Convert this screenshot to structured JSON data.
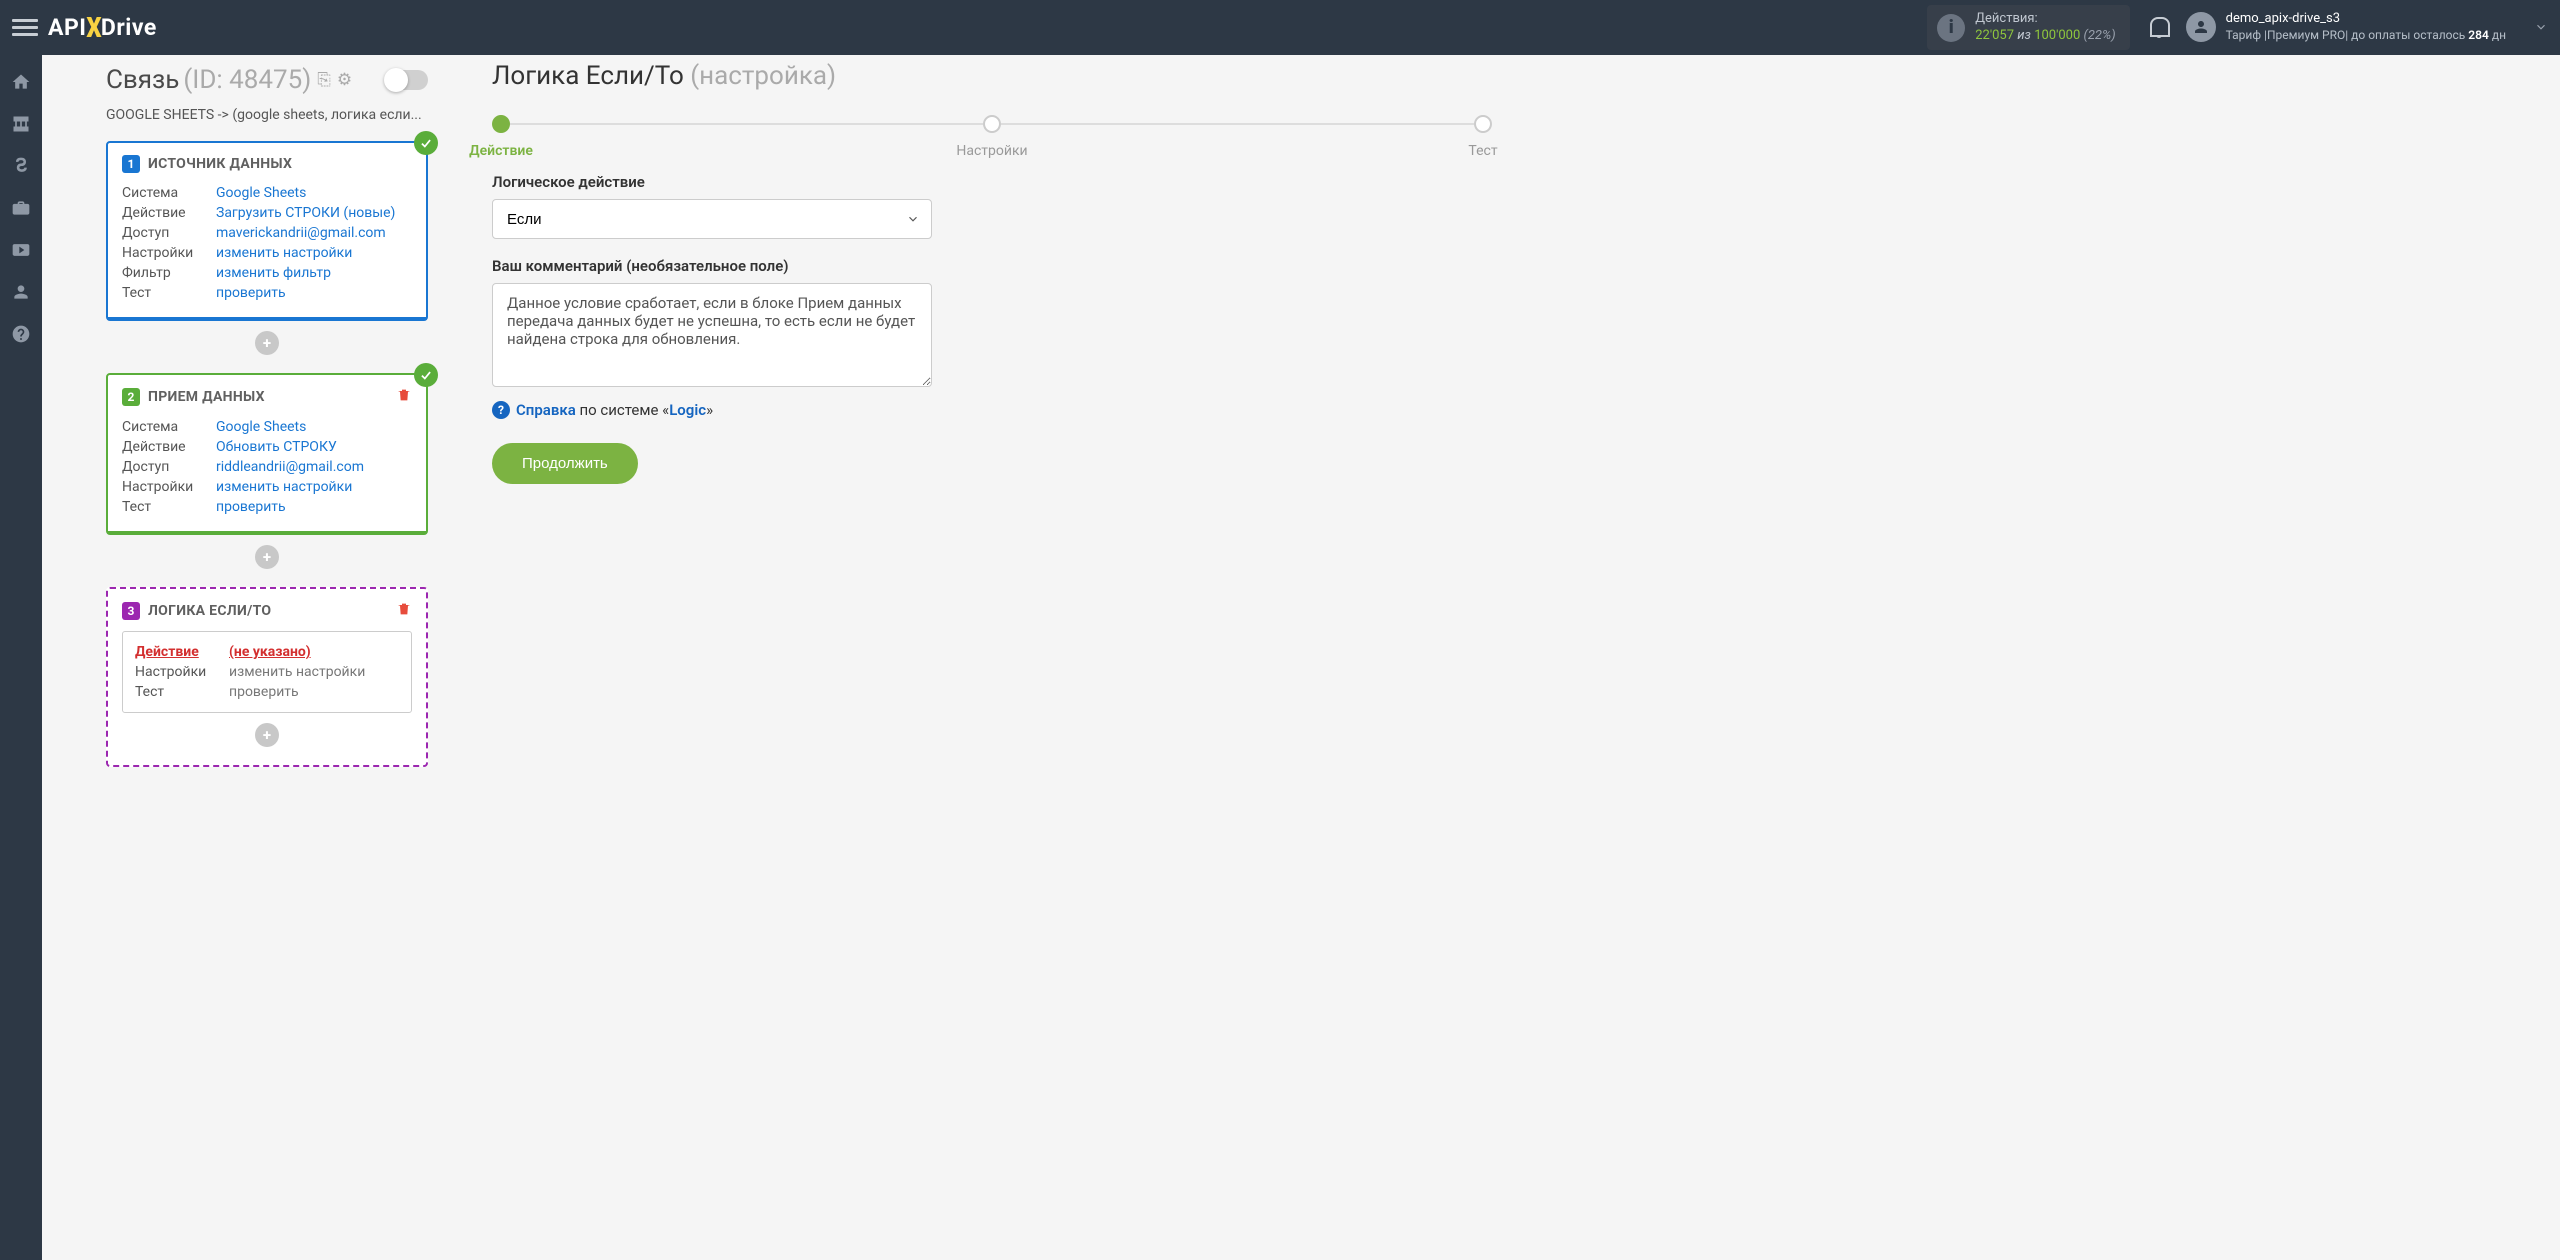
{
  "header": {
    "logo_part1": "API",
    "logo_part2": "Drive",
    "actions_label": "Действия:",
    "actions_used": "22'057",
    "actions_of": "из",
    "actions_total": "100'000",
    "actions_pct": "(22%)",
    "user_name": "demo_apix-drive_s3",
    "tariff_prefix": "Тариф |Премиум PRO| до оплаты осталось ",
    "tariff_days": "284",
    "tariff_suffix": " дн"
  },
  "connection": {
    "title": "Связь",
    "id": "(ID: 48475)",
    "subtitle": "GOOGLE SHEETS -> (google sheets, логика если..."
  },
  "card1": {
    "num": "1",
    "title": "ИСТОЧНИК ДАННЫХ",
    "rows": {
      "system_lbl": "Система",
      "system_val": "Google Sheets",
      "action_lbl": "Действие",
      "action_val": "Загрузить СТРОКИ (новые)",
      "access_lbl": "Доступ",
      "access_val": "maverickandrii@gmail.com",
      "settings_lbl": "Настройки",
      "settings_val": "изменить настройки",
      "filter_lbl": "Фильтр",
      "filter_val": "изменить фильтр",
      "test_lbl": "Тест",
      "test_val": "проверить"
    }
  },
  "card2": {
    "num": "2",
    "title": "ПРИЕМ ДАННЫХ",
    "rows": {
      "system_lbl": "Система",
      "system_val": "Google Sheets",
      "action_lbl": "Действие",
      "action_val": "Обновить СТРОКУ",
      "access_lbl": "Доступ",
      "access_val": "riddleandrii@gmail.com",
      "settings_lbl": "Настройки",
      "settings_val": "изменить настройки",
      "test_lbl": "Тест",
      "test_val": "проверить"
    }
  },
  "card3": {
    "num": "3",
    "title": "ЛОГИКА ЕСЛИ/ТО",
    "rows": {
      "action_lbl": "Действие",
      "action_val": "(не указано)",
      "settings_lbl": "Настройки",
      "settings_val": "изменить настройки",
      "test_lbl": "Тест",
      "test_val": "проверить"
    }
  },
  "right": {
    "title": "Логика Если/То",
    "title_sub": "(настройка)",
    "step1": "Действие",
    "step2": "Настройки",
    "step3": "Тест",
    "label_action": "Логическое действие",
    "select_value": "Если",
    "label_comment": "Ваш комментарий (необязательное поле)",
    "comment_value": "Данное условие сработает, если в блоке Прием данных передача данных будет не успешна, то есть если не будет найдена строка для обновления.",
    "help_word": "Справка",
    "help_middle": " по системе «",
    "help_system": "Logic",
    "help_close": "»",
    "continue": "Продолжить"
  }
}
